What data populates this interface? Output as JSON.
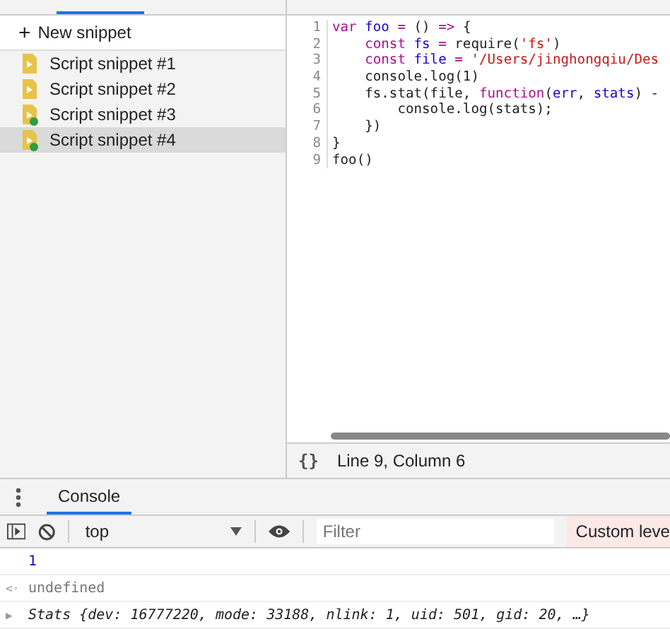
{
  "new_snippet": {
    "icon": "+",
    "label": "New snippet"
  },
  "snippets": [
    {
      "label": "Script snippet #1",
      "running": false,
      "selected": false
    },
    {
      "label": "Script snippet #2",
      "running": false,
      "selected": false
    },
    {
      "label": "Script snippet #3",
      "running": true,
      "selected": false
    },
    {
      "label": "Script snippet #4",
      "running": true,
      "selected": true
    }
  ],
  "editor": {
    "lines": [
      {
        "number": "1",
        "tokens": [
          {
            "kind": "keyword",
            "text": "var"
          },
          {
            "kind": "name",
            "text": " foo"
          },
          {
            "kind": "operator",
            "text": " ="
          },
          {
            "kind": "plain",
            "text": " () "
          },
          {
            "kind": "operator",
            "text": "=>"
          },
          {
            "kind": "plain",
            "text": " {"
          }
        ]
      },
      {
        "number": "2",
        "tokens": [
          {
            "kind": "keyword",
            "text": "    const"
          },
          {
            "kind": "name",
            "text": " fs"
          },
          {
            "kind": "operator",
            "text": " ="
          },
          {
            "kind": "plain",
            "text": " require("
          },
          {
            "kind": "string",
            "text": "'fs'"
          },
          {
            "kind": "plain",
            "text": ")"
          }
        ]
      },
      {
        "number": "3",
        "tokens": [
          {
            "kind": "keyword",
            "text": "    const"
          },
          {
            "kind": "name",
            "text": " file"
          },
          {
            "kind": "operator",
            "text": " ="
          },
          {
            "kind": "string",
            "text": " '/Users/jinghongqiu/Des"
          }
        ]
      },
      {
        "number": "4",
        "tokens": [
          {
            "kind": "plain",
            "text": "    console.log(1)"
          }
        ]
      },
      {
        "number": "5",
        "tokens": [
          {
            "kind": "plain",
            "text": "    fs.stat(file, "
          },
          {
            "kind": "keyword",
            "text": "function"
          },
          {
            "kind": "plain",
            "text": "("
          },
          {
            "kind": "name",
            "text": "err"
          },
          {
            "kind": "plain",
            "text": ", "
          },
          {
            "kind": "name",
            "text": "stats"
          },
          {
            "kind": "plain",
            "text": ") -"
          }
        ]
      },
      {
        "number": "6",
        "tokens": [
          {
            "kind": "plain",
            "text": "        console.log(stats);"
          }
        ]
      },
      {
        "number": "7",
        "tokens": [
          {
            "kind": "plain",
            "text": "    })"
          }
        ]
      },
      {
        "number": "8",
        "tokens": [
          {
            "kind": "plain",
            "text": "}"
          }
        ]
      },
      {
        "number": "9",
        "tokens": [
          {
            "kind": "plain",
            "text": "foo()"
          }
        ]
      }
    ]
  },
  "status_bar": {
    "format_icon": "{}",
    "position": "Line 9, Column 6"
  },
  "drawer": {
    "tabs": [
      {
        "label": "Console",
        "selected": true
      }
    ]
  },
  "console_toolbar": {
    "context": "top",
    "filter_placeholder": "Filter",
    "levels": "Custom leve"
  },
  "messages": [
    {
      "kind": "log",
      "text": "1"
    },
    {
      "kind": "result",
      "icon": "<·",
      "text": "undefined"
    },
    {
      "kind": "object",
      "icon": "▶",
      "text": "Stats {dev: 16777220, mode: 33188, nlink: 1, uid: 501, gid: 20, …}"
    }
  ]
}
